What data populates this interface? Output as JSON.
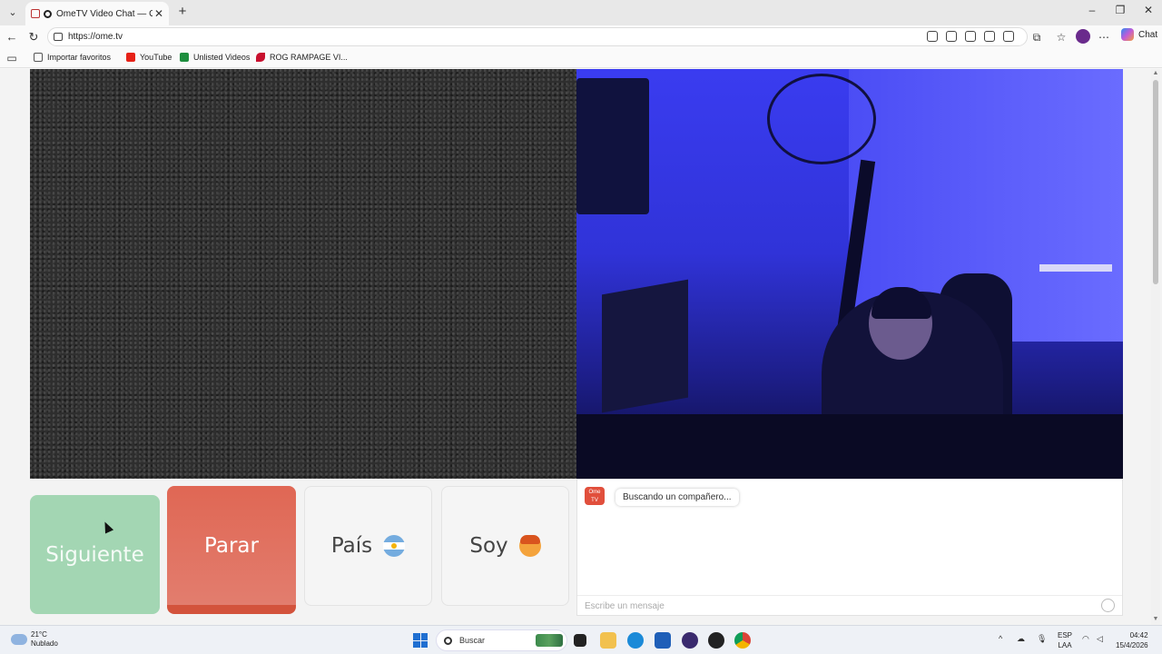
{
  "browser": {
    "tab_title": "OmeTV Video Chat — Omeg",
    "url": "https://ome.tv",
    "copilot_label": "Chat",
    "bookmarks": [
      {
        "label": "Importar favoritos",
        "icon": "folder-icon"
      },
      {
        "label": "YouTube",
        "icon": "youtube-icon"
      },
      {
        "label": "Unlisted Videos",
        "icon": "sheet-icon"
      },
      {
        "label": "ROG RAMPAGE VI...",
        "icon": "rog-icon"
      }
    ]
  },
  "controls": {
    "next_label": "Siguiente",
    "stop_label": "Parar",
    "country_label": "País",
    "gender_label": "Soy"
  },
  "chat": {
    "logo_text": "Ome TV",
    "status_message": "Buscando un compañero...",
    "input_placeholder": "Escribe un mensaje"
  },
  "taskbar": {
    "temperature": "21°C",
    "weather": "Nublado",
    "search_placeholder": "Buscar",
    "language_top": "ESP",
    "language_bottom": "LAA",
    "time": "04:42",
    "date": "15/4/2026"
  },
  "colors": {
    "next_button": "#a3d6b3",
    "stop_button": "#e06754",
    "neutral_button": "#f5f5f5"
  }
}
